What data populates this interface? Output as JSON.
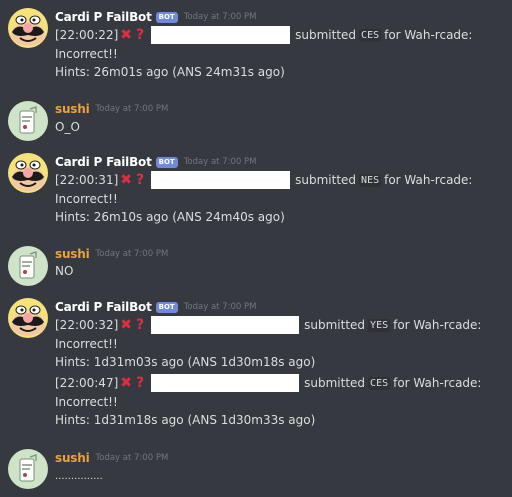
{
  "messages": [
    {
      "username": "Cardi P FailBot",
      "bot_tag": "BOT",
      "timestamp": "Today at 7:00 PM",
      "avatar_icon": "wario-face-icon",
      "entries": [
        {
          "time": "[22:00:22]",
          "submitted_label": "submitted",
          "code": "CES",
          "target": "for Wah-rcade:",
          "result": "Incorrect!!",
          "hints": "Hints: 26m01s ago (ANS 24m31s ago)"
        }
      ]
    },
    {
      "username": "sushi",
      "timestamp": "Today at 7:00 PM",
      "avatar_icon": "sushi-avatar-icon",
      "text": "O_O"
    },
    {
      "username": "Cardi P FailBot",
      "bot_tag": "BOT",
      "timestamp": "Today at 7:00 PM",
      "avatar_icon": "wario-face-icon",
      "entries": [
        {
          "time": "[22:00:31]",
          "submitted_label": "submitted",
          "code": "NES",
          "target": "for Wah-rcade:",
          "result": "Incorrect!!",
          "hints": "Hints: 26m10s ago (ANS 24m40s ago)"
        }
      ]
    },
    {
      "username": "sushi",
      "timestamp": "Today at 7:00 PM",
      "avatar_icon": "sushi-avatar-icon",
      "text": "NO"
    },
    {
      "username": "Cardi P FailBot",
      "bot_tag": "BOT",
      "timestamp": "Today at 7:00 PM",
      "avatar_icon": "wario-face-icon",
      "entries": [
        {
          "time": "[22:00:32]",
          "submitted_label": "submitted",
          "code": "YES",
          "target": "for Wah-rcade:",
          "result": "Incorrect!!",
          "hints": "Hints: 1d31m03s ago (ANS 1d30m18s ago)"
        },
        {
          "time": "[22:00:47]",
          "submitted_label": "submitted",
          "code": "CES",
          "target": "for Wah-rcade:",
          "result": "Incorrect!!",
          "hints": "Hints: 1d31m18s ago (ANS 1d30m33s ago)"
        }
      ]
    },
    {
      "username": "sushi",
      "timestamp": "Today at 7:00 PM",
      "avatar_icon": "sushi-avatar-icon",
      "text": "..............."
    }
  ]
}
